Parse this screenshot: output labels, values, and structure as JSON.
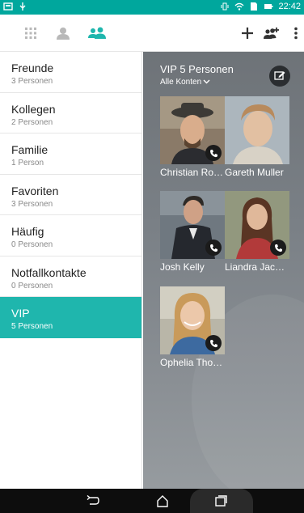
{
  "statusbar": {
    "time": "22:42",
    "icons": [
      "notification-icon",
      "usb-icon",
      "vibrate-icon",
      "wifi-icon",
      "sim-icon",
      "battery-icon"
    ]
  },
  "toolbar": {
    "tabs": [
      "dialpad-tab-icon",
      "contacts-tab-icon",
      "groups-tab-icon"
    ],
    "actions": [
      "add-icon",
      "add-group-icon",
      "more-icon"
    ]
  },
  "groups": [
    {
      "name": "Freunde",
      "count": "3 Personen"
    },
    {
      "name": "Kollegen",
      "count": "2 Personen"
    },
    {
      "name": "Familie",
      "count": "1 Person"
    },
    {
      "name": "Favoriten",
      "count": "3 Personen"
    },
    {
      "name": "Häufig",
      "count": "0 Personen"
    },
    {
      "name": "Notfallkontakte",
      "count": "0 Personen"
    },
    {
      "name": "VIP",
      "count": "5 Personen"
    }
  ],
  "detail": {
    "title": "VIP 5 Personen",
    "account_filter": "Alle Konten",
    "contacts": [
      {
        "name": "Christian Ro…"
      },
      {
        "name": "Gareth Muller"
      },
      {
        "name": "Josh Kelly"
      },
      {
        "name": "Liandra Jac…"
      },
      {
        "name": "Ophelia Tho…"
      }
    ]
  },
  "colors": {
    "accent": "#00a79d",
    "selected_row": "#1fb6ad"
  }
}
